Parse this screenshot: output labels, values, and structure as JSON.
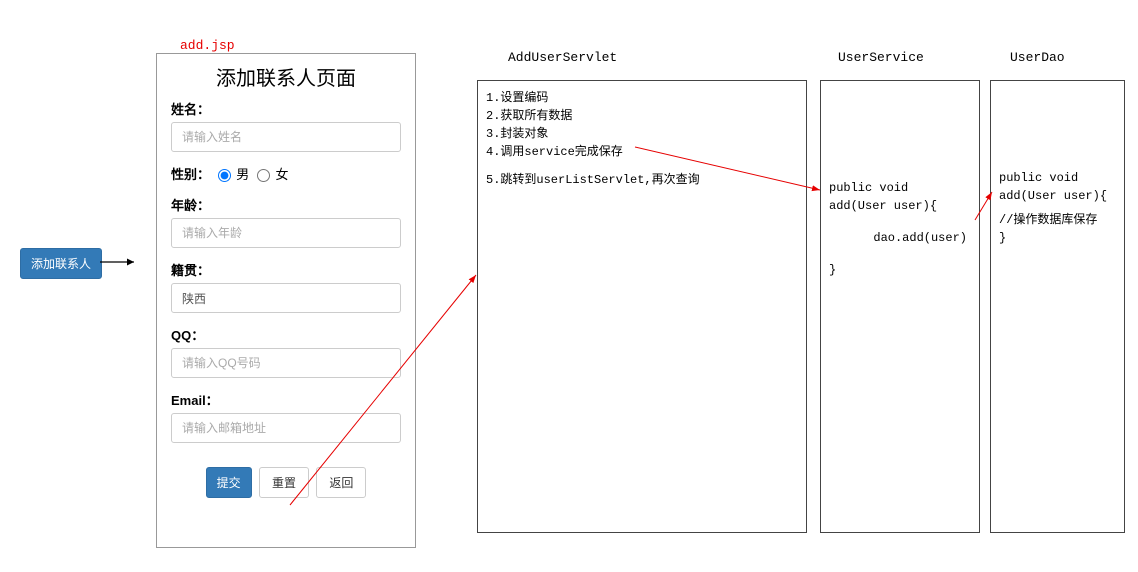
{
  "entryButton": "添加联系人",
  "jspLabel": "add.jsp",
  "form": {
    "title": "添加联系人页面",
    "nameLabel": "姓名：",
    "namePlaceholder": "请输入姓名",
    "genderLabel": "性别：",
    "genderMale": "男",
    "genderFemale": "女",
    "ageLabel": "年龄：",
    "agePlaceholder": "请输入年龄",
    "hometownLabel": "籍贯：",
    "hometownValue": "陕西",
    "qqLabel": "QQ：",
    "qqPlaceholder": "请输入QQ号码",
    "emailLabel": "Email：",
    "emailPlaceholder": "请输入邮箱地址",
    "submit": "提交",
    "reset": "重置",
    "back": "返回"
  },
  "servlet": {
    "header": "AddUserServlet",
    "line1": "1.设置编码",
    "line2": "2.获取所有数据",
    "line3": "3.封装对象",
    "line4": "4.调用service完成保存",
    "line5": "5.跳转到userListServlet,再次查询"
  },
  "service": {
    "header": "UserService",
    "line1": "public void add(User user){",
    "line2": "dao.add(user)",
    "line3": "}"
  },
  "dao": {
    "header": "UserDao",
    "line1": "public void add(User user){",
    "line2comment": "//操作数据库保存",
    "line3": "}"
  }
}
